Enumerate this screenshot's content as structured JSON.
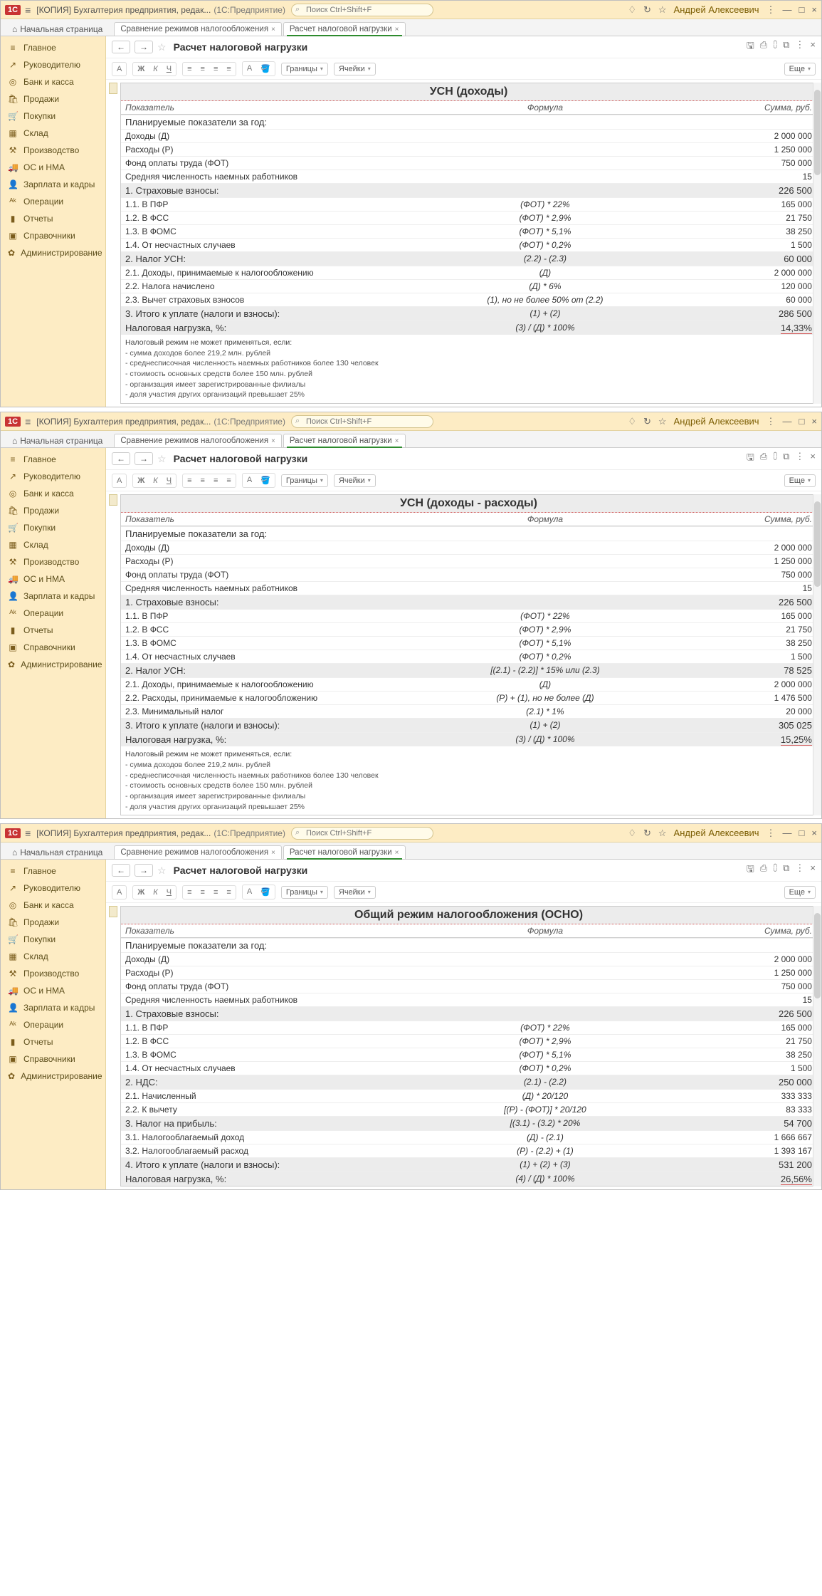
{
  "app": {
    "title": "[КОПИЯ] Бухгалтерия предприятия, редак...",
    "subtitle": "(1С:Предприятие)",
    "search_placeholder": "Поиск Ctrl+Shift+F",
    "user": "Андрей Алексеевич"
  },
  "tabs": {
    "home": "Начальная страница",
    "t1": "Сравнение режимов налогообложения",
    "t2": "Расчет налоговой нагрузки"
  },
  "sidebar": [
    {
      "icon": "≡",
      "label": "Главное"
    },
    {
      "icon": "↗",
      "label": "Руководителю"
    },
    {
      "icon": "◎",
      "label": "Банк и касса"
    },
    {
      "icon": "🛍",
      "label": "Продажи"
    },
    {
      "icon": "🛒",
      "label": "Покупки"
    },
    {
      "icon": "▦",
      "label": "Склад"
    },
    {
      "icon": "⚒",
      "label": "Производство"
    },
    {
      "icon": "🚚",
      "label": "ОС и НМА"
    },
    {
      "icon": "👤",
      "label": "Зарплата и кадры"
    },
    {
      "icon": "ᴬᵏ",
      "label": "Операции"
    },
    {
      "icon": "▮",
      "label": "Отчеты"
    },
    {
      "icon": "▣",
      "label": "Справочники"
    },
    {
      "icon": "✿",
      "label": "Администрирование"
    }
  ],
  "page_title": "Расчет налоговой нагрузки",
  "toolbar": {
    "borders": "Границы",
    "cells": "Ячейки",
    "more": "Еще",
    "A": "A",
    "B": "Ж",
    "I": "К",
    "U": "Ч"
  },
  "cols": {
    "c1": "Показатель",
    "c2": "Формула",
    "c3": "Сумма, руб."
  },
  "planned_header": "Планируемые показатели за год:",
  "planned": [
    {
      "label": "Доходы (Д)",
      "formula": "",
      "value": "2 000 000"
    },
    {
      "label": "Расходы (Р)",
      "formula": "",
      "value": "1 250 000"
    },
    {
      "label": "Фонд оплаты труда (ФОТ)",
      "formula": "",
      "value": "750 000"
    },
    {
      "label": "Средняя численность наемных работников",
      "formula": "",
      "value": "15"
    }
  ],
  "contrib_header": {
    "label": "1. Страховые взносы:",
    "formula": "",
    "value": "226 500"
  },
  "contrib": [
    {
      "label": "1.1. В ПФР",
      "formula": "(ФОТ) * 22%",
      "value": "165 000"
    },
    {
      "label": "1.2. В ФСС",
      "formula": "(ФОТ) * 2,9%",
      "value": "21 750"
    },
    {
      "label": "1.3. В ФОМС",
      "formula": "(ФОТ) * 5,1%",
      "value": "38 250"
    },
    {
      "label": "1.4. От несчастных случаев",
      "formula": "(ФОТ) * 0,2%",
      "value": "1 500"
    }
  ],
  "notes": {
    "title": "Налоговый режим не может применяться, если:",
    "lines": [
      "- сумма доходов более 219,2 млн. рублей",
      "- среднесписочная численность наемных работников более 130 человек",
      "- стоимость основных средств более 150 млн. рублей",
      "- организация имеет зарегистрированные филиалы",
      "- доля участия других организаций превышает 25%"
    ]
  },
  "screens": [
    {
      "big_title": "УСН (доходы)",
      "tax_header": {
        "label": "2. Налог УСН:",
        "formula": "(2.2) - (2.3)",
        "value": "60 000"
      },
      "tax_rows": [
        {
          "label": "2.1. Доходы, принимаемые к налогообложению",
          "formula": "(Д)",
          "value": "2 000 000"
        },
        {
          "label": "2.2. Налога начислено",
          "formula": "(Д) * 6%",
          "value": "120 000"
        },
        {
          "label": "2.3. Вычет страховых взносов",
          "formula": "(1), но не более 50% от (2.2)",
          "value": "60 000"
        }
      ],
      "sections_extra": [],
      "total": {
        "label": "3. Итого к уплате (налоги и взносы):",
        "formula": "(1) + (2)",
        "value": "286 500"
      },
      "burden": {
        "label": "Налоговая нагрузка, %:",
        "formula": "(3) / (Д) * 100%",
        "value": "14,33%"
      }
    },
    {
      "big_title": "УСН (доходы - расходы)",
      "tax_header": {
        "label": "2. Налог УСН:",
        "formula": "[(2.1) - (2.2)] * 15% или (2.3)",
        "value": "78 525"
      },
      "tax_rows": [
        {
          "label": "2.1. Доходы, принимаемые к налогообложению",
          "formula": "(Д)",
          "value": "2 000 000"
        },
        {
          "label": "2.2. Расходы, принимаемые к налогообложению",
          "formula": "(Р) + (1), но не более (Д)",
          "value": "1 476 500"
        },
        {
          "label": "2.3. Минимальный налог",
          "formula": "(2.1) * 1%",
          "value": "20 000"
        }
      ],
      "sections_extra": [],
      "total": {
        "label": "3. Итого к уплате (налоги и взносы):",
        "formula": "(1) + (2)",
        "value": "305 025"
      },
      "burden": {
        "label": "Налоговая нагрузка, %:",
        "formula": "(3) / (Д) * 100%",
        "value": "15,25%"
      }
    },
    {
      "big_title": "Общий режим налогообложения (ОСНО)",
      "tax_header": {
        "label": "2. НДС:",
        "formula": "(2.1) - (2.2)",
        "value": "250 000"
      },
      "tax_rows": [
        {
          "label": "2.1. Начисленный",
          "formula": "(Д) * 20/120",
          "value": "333 333"
        },
        {
          "label": "2.2. К вычету",
          "formula": "[(Р) - (ФОТ)] * 20/120",
          "value": "83 333"
        }
      ],
      "sections_extra": [
        {
          "header": {
            "label": "3. Налог на прибыль:",
            "formula": "[(3.1) - (3.2) * 20%",
            "value": "54 700"
          },
          "rows": [
            {
              "label": "3.1. Налогооблагаемый доход",
              "formula": "(Д)  - (2.1)",
              "value": "1 666 667"
            },
            {
              "label": "3.2. Налогооблагаемый расход",
              "formula": "(Р) - (2.2)  + (1)",
              "value": "1 393 167"
            }
          ]
        }
      ],
      "total": {
        "label": "4. Итого к уплате (налоги и взносы):",
        "formula": "(1) + (2) + (3)",
        "value": "531 200"
      },
      "burden": {
        "label": "Налоговая нагрузка, %:",
        "formula": "(4) / (Д) * 100%",
        "value": "26,56%"
      },
      "hide_notes": true
    }
  ]
}
